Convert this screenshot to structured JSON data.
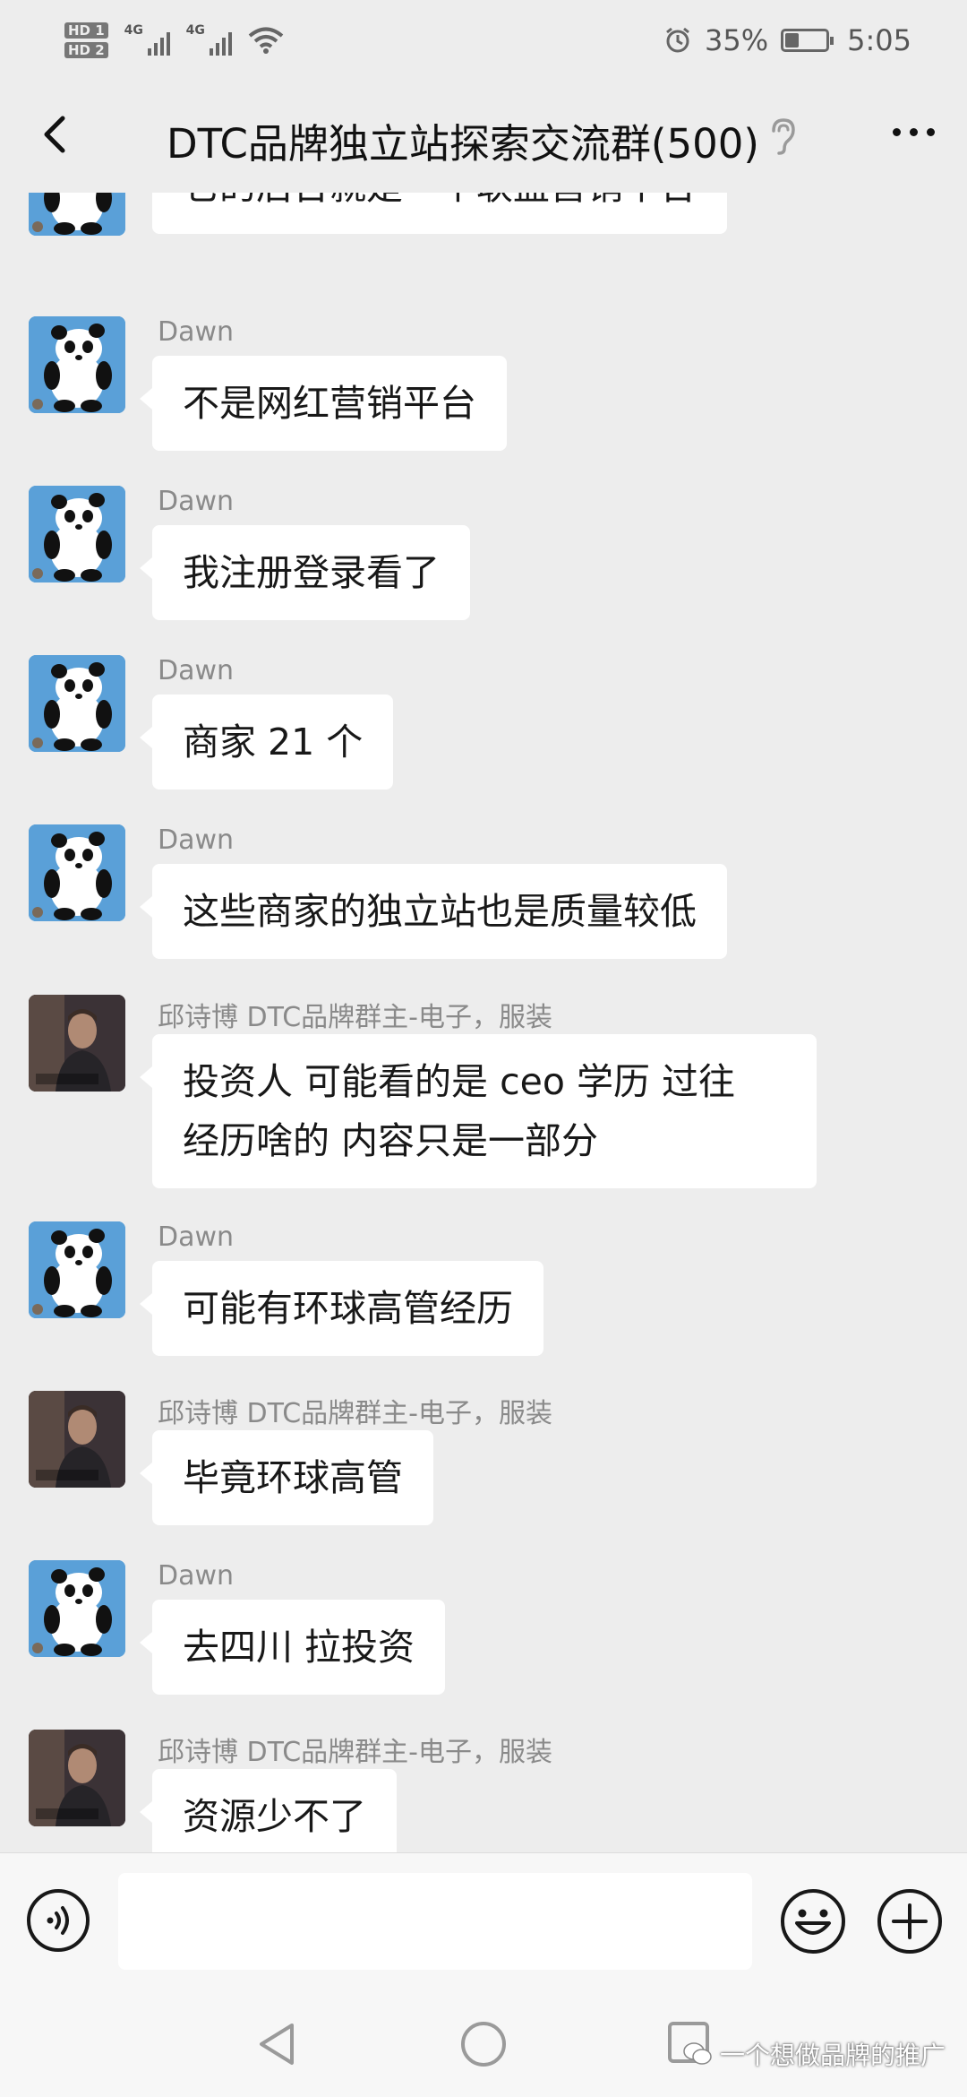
{
  "status_bar": {
    "hd1": "HD 1",
    "hd2": "HD 2",
    "net1": "4G",
    "net2": "4G",
    "battery_percent": "35%",
    "battery_level": 0.35,
    "time": "5:05"
  },
  "header": {
    "title": "DTC品牌独立站探索交流群(500)"
  },
  "messages": [
    {
      "sender": "",
      "text": "它的后台就是一个联盟营销平台",
      "avatar": "panda"
    },
    {
      "sender": "Dawn",
      "text": "不是网红营销平台",
      "avatar": "panda"
    },
    {
      "sender": "Dawn",
      "text": "我注册登录看了",
      "avatar": "panda"
    },
    {
      "sender": "Dawn",
      "text": "商家 21 个",
      "avatar": "panda"
    },
    {
      "sender": "Dawn",
      "text": "这些商家的独立站也是质量较低",
      "avatar": "panda"
    },
    {
      "sender": "邱诗博 DTC品牌群主-电子，服装",
      "text": "投资人 可能看的是 ceo 学历 过往",
      "text2": "经历啥的 内容只是一部分",
      "avatar": "person"
    },
    {
      "sender": "Dawn",
      "text": "可能有环球高管经历",
      "avatar": "panda"
    },
    {
      "sender": "邱诗博 DTC品牌群主-电子，服装",
      "text": "毕竟环球高管",
      "avatar": "person"
    },
    {
      "sender": "Dawn",
      "text": "去四川 拉投资",
      "avatar": "panda"
    },
    {
      "sender": "邱诗博 DTC品牌群主-电子，服装",
      "text": "资源少不了",
      "avatar": "person"
    }
  ],
  "input": {
    "value": ""
  },
  "watermark": {
    "text": "一个想做品牌的推广"
  },
  "icons": [
    "back-icon",
    "ear-icon",
    "more-icon",
    "voice-icon",
    "emoji-icon",
    "plus-icon",
    "nav-back-icon",
    "nav-home-icon",
    "nav-recent-icon",
    "wechat-icon"
  ]
}
